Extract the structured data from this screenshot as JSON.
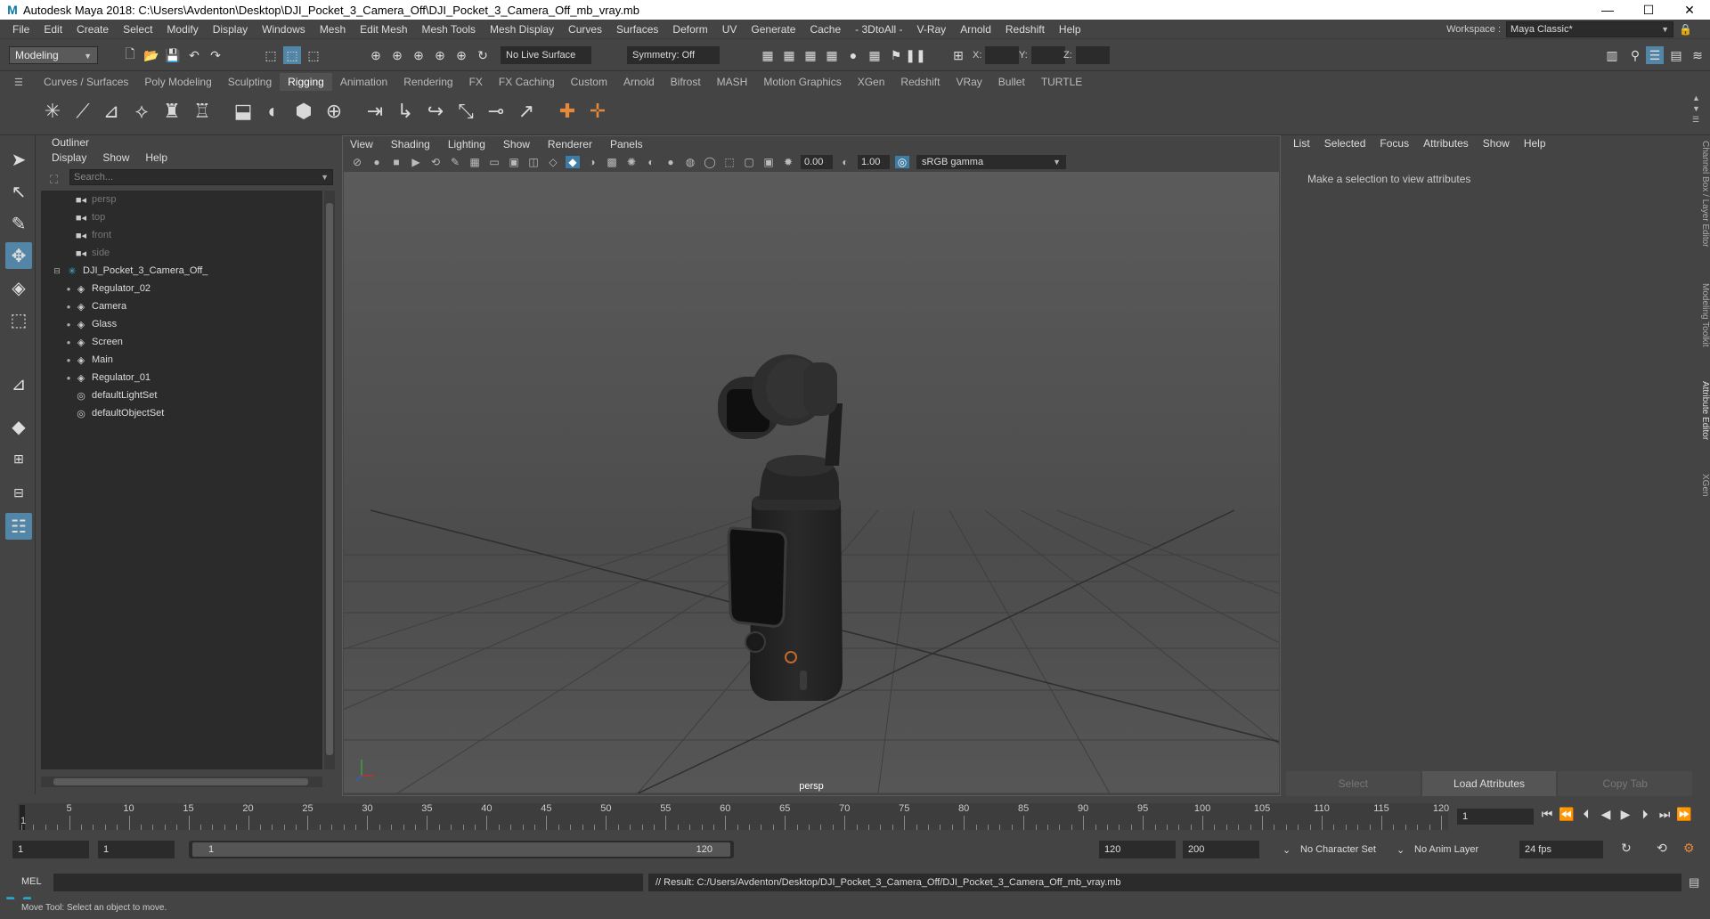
{
  "window": {
    "title": "Autodesk Maya 2018: C:\\Users\\Avdenton\\Desktop\\DJI_Pocket_3_Camera_Off\\DJI_Pocket_3_Camera_Off_mb_vray.mb",
    "minimize": "—",
    "maximize": "☐",
    "close": "✕"
  },
  "menubar": {
    "items": [
      "File",
      "Edit",
      "Create",
      "Select",
      "Modify",
      "Display",
      "Windows",
      "Mesh",
      "Edit Mesh",
      "Mesh Tools",
      "Mesh Display",
      "Curves",
      "Surfaces",
      "Deform",
      "UV",
      "Generate",
      "Cache",
      "- 3DtoAll -",
      "V-Ray",
      "Arnold",
      "Redshift",
      "Help"
    ],
    "workspace_label": "Workspace :",
    "workspace_value": "Maya Classic*"
  },
  "statusline": {
    "mode": "Modeling",
    "live_surface": "No Live Surface",
    "symmetry": "Symmetry: Off",
    "x_label": "X:",
    "y_label": "Y:",
    "z_label": "Z:"
  },
  "shelf": {
    "tabs": [
      "Curves / Surfaces",
      "Poly Modeling",
      "Sculpting",
      "Rigging",
      "Animation",
      "Rendering",
      "FX",
      "FX Caching",
      "Custom",
      "Arnold",
      "Bifrost",
      "MASH",
      "Motion Graphics",
      "XGen",
      "Redshift",
      "VRay",
      "Bullet",
      "TURTLE"
    ],
    "active_tab": "Rigging"
  },
  "outliner": {
    "title": "Outliner",
    "menu": [
      "Display",
      "Show",
      "Help"
    ],
    "search_placeholder": "Search...",
    "cameras": [
      "persp",
      "top",
      "front",
      "side"
    ],
    "group": "DJI_Pocket_3_Camera_Off_",
    "children": [
      "Regulator_02",
      "Camera",
      "Glass",
      "Screen",
      "Main",
      "Regulator_01"
    ],
    "sets": [
      "defaultLightSet",
      "defaultObjectSet"
    ]
  },
  "viewport": {
    "menu": [
      "View",
      "Shading",
      "Lighting",
      "Show",
      "Renderer",
      "Panels"
    ],
    "exposure": "0.00",
    "gamma": "1.00",
    "color_space": "sRGB gamma",
    "camera_label": "persp"
  },
  "attribute_editor": {
    "menu": [
      "List",
      "Selected",
      "Focus",
      "Attributes",
      "Show",
      "Help"
    ],
    "message": "Make a selection to view attributes",
    "buttons": [
      "Select",
      "Load Attributes",
      "Copy Tab"
    ]
  },
  "side_tabs": [
    "Channel Box / Layer Editor",
    "Modeling Toolkit",
    "Attribute Editor",
    "XGen"
  ],
  "timeslider": {
    "labels": [
      "5",
      "10",
      "15",
      "20",
      "25",
      "30",
      "35",
      "40",
      "45",
      "50",
      "55",
      "60",
      "65",
      "70",
      "75",
      "80",
      "85",
      "90",
      "95",
      "100",
      "105",
      "110",
      "115",
      "120"
    ],
    "current_label": "1",
    "current_frame": "1"
  },
  "rangeslider": {
    "start": "1",
    "playback_start": "1",
    "bar_start": "1",
    "bar_end": "120",
    "playback_end": "120",
    "end": "200",
    "character_set": "No Character Set",
    "anim_layer": "No Anim Layer",
    "fps": "24 fps"
  },
  "commandline": {
    "language": "MEL",
    "result": "// Result: C:/Users/Avdenton/Desktop/DJI_Pocket_3_Camera_Off/DJI_Pocket_3_Camera_Off_mb_vray.mb"
  },
  "helpline": "Move Tool: Select an object to move.",
  "colors": {
    "accent": "#5285a6",
    "maya_logo": "#27a6c9",
    "panel_bg": "#444444",
    "field_bg": "#2b2b2b"
  }
}
